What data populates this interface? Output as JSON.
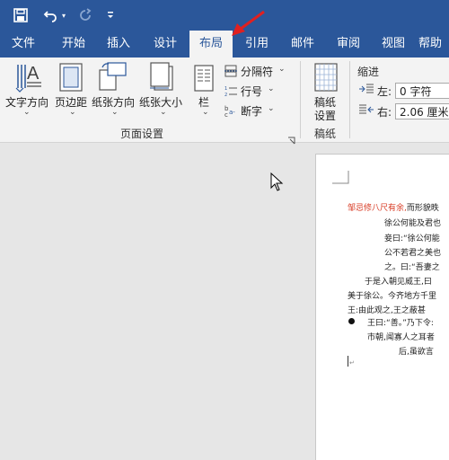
{
  "quick_access": {
    "save_icon": "save-icon",
    "undo_icon": "undo-icon",
    "redo_icon": "redo-icon",
    "customize_icon": "customize-qat-icon"
  },
  "tabs": [
    {
      "label": "文件"
    },
    {
      "label": "开始"
    },
    {
      "label": "插入"
    },
    {
      "label": "设计"
    },
    {
      "label": "布局",
      "active": true
    },
    {
      "label": "引用"
    },
    {
      "label": "邮件"
    },
    {
      "label": "审阅"
    },
    {
      "label": "视图"
    },
    {
      "label": "帮助"
    }
  ],
  "ribbon": {
    "text_direction": "文字方向",
    "margins": "页边距",
    "orientation": "纸张方向",
    "size": "纸张大小",
    "columns": "栏",
    "breaks": "分隔符",
    "line_numbers": "行号",
    "hyphenation": "断字",
    "page_setup_group": "页面设置",
    "manuscript_setup": "稿纸\n设置",
    "manuscript_line1": "稿纸",
    "manuscript_line2": "设置",
    "manuscript_group": "稿纸",
    "indent_group": "缩进",
    "indent_left_label": "左:",
    "indent_left_value": "0 字符",
    "indent_right_label": "右:",
    "indent_right_value": "2.06 厘米"
  },
  "document": {
    "lines": [
      {
        "red": "邹忌修八尺有余,",
        "text": "而形貌昳"
      },
      {
        "text": "徐公何能及君也"
      },
      {
        "text": "妾曰:“徐公何能"
      },
      {
        "text": "公不若君之美也"
      },
      {
        "text": "之。曰:“吾妻之"
      },
      {
        "text": "于是入朝见威王,曰"
      },
      {
        "text": "美于徐公。今齐地方千里"
      },
      {
        "text": "王:由此观之,王之蔽甚"
      },
      {
        "text": "王曰:“善。”乃下令:"
      },
      {
        "text": "市朝,闻寡人之耳者"
      },
      {
        "text": "后,虽欲言"
      }
    ]
  },
  "colors": {
    "accent": "#2b579a",
    "arrow": "#e02020"
  }
}
